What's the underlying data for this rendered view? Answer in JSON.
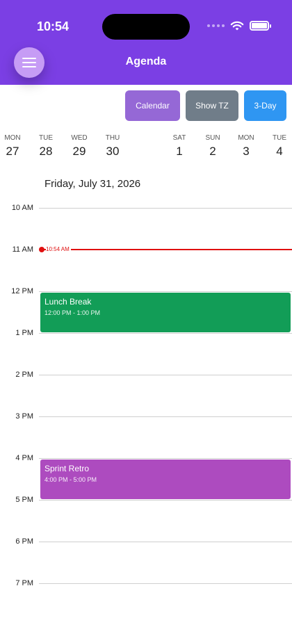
{
  "status_bar": {
    "time": "10:54"
  },
  "header": {
    "title": "Agenda"
  },
  "toolbar": {
    "calendar_label": "Calendar",
    "show_tz_label": "Show TZ",
    "three_day_label": "3-Day"
  },
  "week": [
    {
      "dow": "MON",
      "date": "27"
    },
    {
      "dow": "TUE",
      "date": "28"
    },
    {
      "dow": "WED",
      "date": "29"
    },
    {
      "dow": "THU",
      "date": "30"
    },
    {
      "dow": "SAT",
      "date": "1"
    },
    {
      "dow": "SUN",
      "date": "2"
    },
    {
      "dow": "MON",
      "date": "3"
    },
    {
      "dow": "TUE",
      "date": "4"
    }
  ],
  "selected_date": "Friday, July 31, 2026",
  "hours": [
    "10 AM",
    "11 AM",
    "12 PM",
    "1 PM",
    "2 PM",
    "3 PM",
    "4 PM",
    "5 PM",
    "6 PM",
    "7 PM"
  ],
  "now_indicator": {
    "label": "10:54 AM",
    "color": "#e01010"
  },
  "events": [
    {
      "title": "Lunch Break",
      "time": "12:00 PM - 1:00 PM",
      "color": "#129d57"
    },
    {
      "title": "Sprint Retro",
      "time": "4:00 PM - 5:00 PM",
      "color": "#ad4bbf"
    }
  ],
  "colors": {
    "header_bg": "#7b3fe4",
    "menu_button": "#c69cf5",
    "calendar_button": "#9568d6",
    "tz_button": "#707d89",
    "three_day_button": "#2f96f2"
  },
  "icons": {
    "menu": "hamburger-icon",
    "wifi": "wifi-icon",
    "battery": "battery-icon",
    "signal": "signal-icon"
  }
}
